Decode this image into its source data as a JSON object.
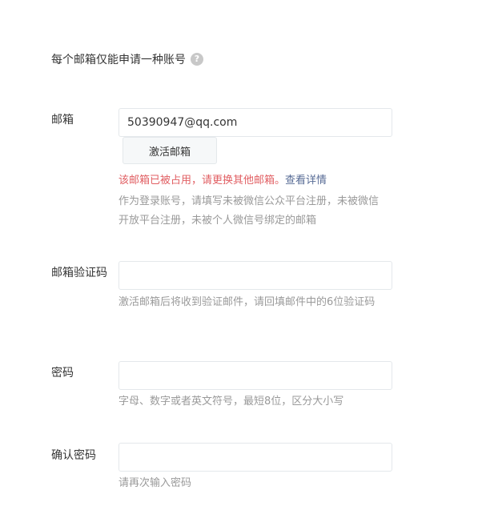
{
  "notice": {
    "text": "每个邮箱仅能申请一种账号",
    "help_glyph": "?"
  },
  "email": {
    "label": "邮箱",
    "value": "50390947@qq.com",
    "activate_button": "激活邮箱",
    "error_text": "该邮箱已被占用，请更换其他邮箱。",
    "error_link": "查看详情",
    "tip": "作为登录账号，请填写未被微信公众平台注册，未被微信开放平台注册，未被个人微信号绑定的邮箱"
  },
  "verify_code": {
    "label": "邮箱验证码",
    "value": "",
    "tip": "激活邮箱后将收到验证邮件，请回填邮件中的6位验证码"
  },
  "password": {
    "label": "密码",
    "value": "",
    "tip": "字母、数字或者英文符号，最短8位，区分大小写"
  },
  "confirm_password": {
    "label": "确认密码",
    "value": "",
    "tip": "请再次输入密码"
  },
  "colors": {
    "error": "#e15f63",
    "link": "#576b95",
    "tip": "#9a9a9a",
    "text": "#353535",
    "border": "#e4e8eb"
  },
  "icons": {
    "help": "question-circle-icon"
  }
}
